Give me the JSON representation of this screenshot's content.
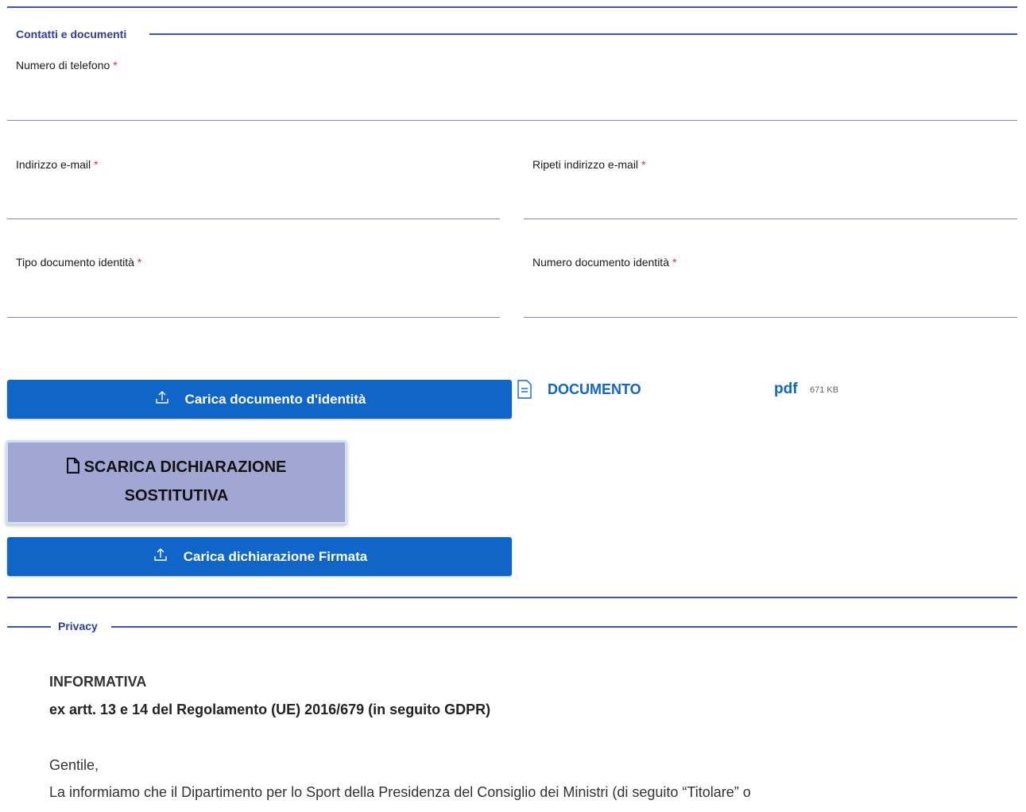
{
  "section_contacts": {
    "legend": "Contatti e documenti",
    "phone_label": "Numero di telefono",
    "email_label": "Indirizzo e-mail",
    "email_repeat_label": "Ripeti indirizzo e-mail",
    "doc_type_label": "Tipo documento identità",
    "doc_number_label": "Numero documento identità",
    "required_mark": "*"
  },
  "upload_id_button": "Carica documento d'identità",
  "attached_file": {
    "name": "DOCUMENTO",
    "ext": "pdf",
    "size": "671 KB"
  },
  "download_declaration_button": {
    "line1": "SCARICA DICHIARAZIONE",
    "line2": "SOSTITUTIVA"
  },
  "upload_signed_button": "Carica dichiarazione Firmata",
  "section_privacy": {
    "legend": "Privacy",
    "heading": "INFORMATIVA",
    "subheading": "ex artt. 13 e 14 del Regolamento (UE) 2016/679 (in seguito GDPR)",
    "greeting": "Gentile,",
    "body": "La informiamo che il Dipartimento per lo Sport della Presidenza del Consiglio dei Ministri (di seguito “Titolare” o"
  },
  "colors": {
    "accent": "#3f51b5",
    "button_blue": "#0f66c8",
    "button_grey": "#a1a6d3",
    "required": "#d32f2f"
  }
}
